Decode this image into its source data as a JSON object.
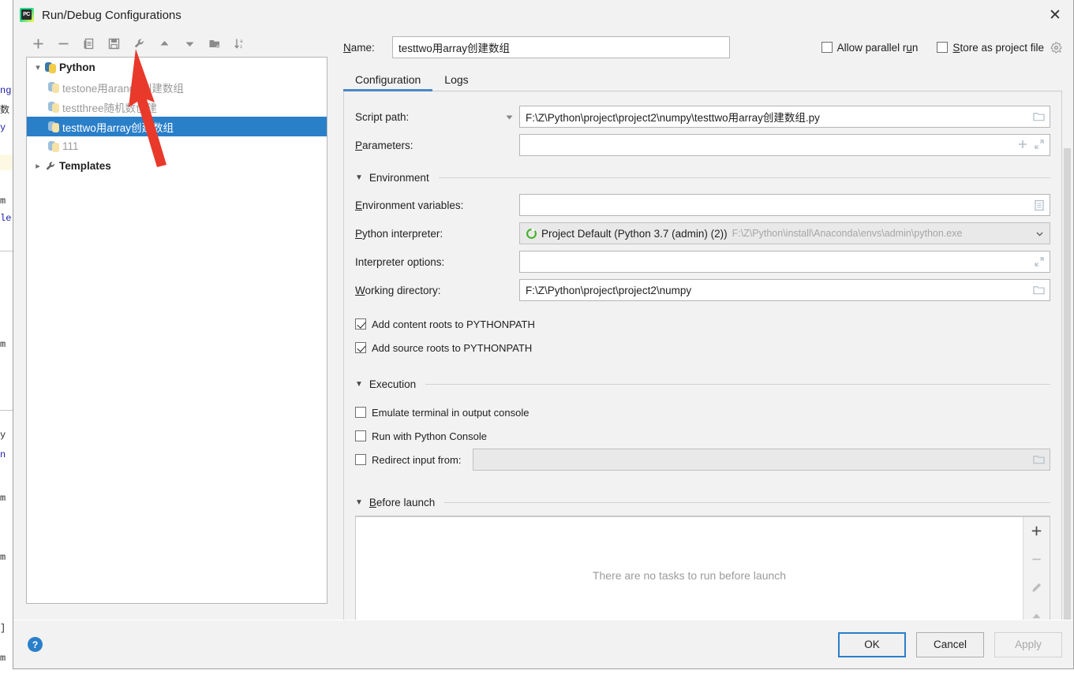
{
  "window": {
    "title": "Run/Debug Configurations",
    "app_icon": "pycharm-icon",
    "close_label": "✕"
  },
  "toolbar": {
    "buttons": [
      {
        "name": "add-configuration-button",
        "icon": "plus-icon",
        "label": "+"
      },
      {
        "name": "remove-configuration-button",
        "icon": "minus-icon",
        "label": "−"
      },
      {
        "name": "copy-configuration-button",
        "icon": "copy-icon",
        "label": ""
      },
      {
        "name": "save-configuration-button",
        "icon": "save-icon",
        "label": ""
      },
      {
        "name": "edit-templates-button",
        "icon": "wrench-icon",
        "label": ""
      },
      {
        "name": "move-up-button",
        "icon": "arrow-up-icon",
        "label": ""
      },
      {
        "name": "move-down-button",
        "icon": "arrow-down-icon",
        "label": ""
      },
      {
        "name": "new-folder-button",
        "icon": "folder-add-icon",
        "label": ""
      },
      {
        "name": "sort-alphabetically-button",
        "icon": "sort-az-icon",
        "label": ""
      }
    ]
  },
  "tree": {
    "nodes": [
      {
        "label": "Python",
        "type": "group",
        "expanded": true,
        "icon": "python-icon",
        "selected": false,
        "muted": false
      },
      {
        "label": "testone用arange创建数组",
        "type": "item",
        "icon": "python-icon",
        "selected": false,
        "muted": true
      },
      {
        "label": "testthree随机数创建",
        "type": "item",
        "icon": "python-icon",
        "selected": false,
        "muted": true
      },
      {
        "label": "testtwo用array创建数组",
        "type": "item",
        "icon": "python-icon",
        "selected": true,
        "muted": false
      },
      {
        "label": "111",
        "type": "item",
        "icon": "python-icon",
        "selected": false,
        "muted": true
      },
      {
        "label": "Templates",
        "type": "group",
        "expanded": false,
        "icon": "wrench-icon",
        "selected": false,
        "muted": false
      }
    ]
  },
  "name_row": {
    "label": "Name:",
    "label_mnemonic": "N",
    "value": "testtwo用array创建数组",
    "allow_parallel_run": {
      "label": "Allow parallel run",
      "checked": false
    },
    "store_as_project_file": {
      "label": "Store as project file",
      "checked": false
    },
    "gear_icon": "gear-icon"
  },
  "tabs": [
    {
      "label": "Configuration",
      "active": true
    },
    {
      "label": "Logs",
      "active": false
    }
  ],
  "configuration": {
    "script_path": {
      "label": "Script path:",
      "value": "F:\\Z\\Python\\project\\project2\\numpy\\testtwo用array创建数组.py",
      "browse_icon": "folder-icon",
      "dropdown_icon": "chevron-down-icon"
    },
    "parameters": {
      "label": "Parameters:",
      "value": "",
      "icons": [
        "plus-icon",
        "expand-icon"
      ]
    },
    "environment_section": {
      "title": "Environment",
      "expanded": true,
      "environment_variables": {
        "label": "Environment variables:",
        "value": "",
        "icon": "list-edit-icon"
      },
      "python_interpreter": {
        "label": "Python interpreter:",
        "value": "Project Default (Python 3.7 (admin) (2))",
        "path": "F:\\Z\\Python\\install\\Anaconda\\envs\\admin\\python.exe",
        "icon": "anaconda-icon",
        "dropdown_icon": "chevron-down-icon"
      },
      "interpreter_options": {
        "label": "Interpreter options:",
        "value": "",
        "icon": "expand-icon"
      },
      "working_directory": {
        "label": "Working directory:",
        "value": "F:\\Z\\Python\\project\\project2\\numpy",
        "browse_icon": "folder-icon"
      },
      "add_content_roots": {
        "label": "Add content roots to PYTHONPATH",
        "checked": true
      },
      "add_source_roots": {
        "label": "Add source roots to PYTHONPATH",
        "checked": true
      }
    },
    "execution_section": {
      "title": "Execution",
      "expanded": true,
      "emulate_terminal": {
        "label": "Emulate terminal in output console",
        "checked": false
      },
      "run_with_python_console": {
        "label": "Run with Python Console",
        "checked": false
      },
      "redirect_input_from": {
        "label": "Redirect input from:",
        "checked": false,
        "value": "",
        "browse_icon": "folder-icon"
      }
    },
    "before_launch": {
      "title": "Before launch",
      "title_mnemonic": "B",
      "expanded": true,
      "empty_text": "There are no tasks to run before launch",
      "tools": [
        {
          "name": "add-task-button",
          "icon": "plus-icon",
          "disabled": false
        },
        {
          "name": "remove-task-button",
          "icon": "minus-icon",
          "disabled": true
        },
        {
          "name": "edit-task-button",
          "icon": "pencil-icon",
          "disabled": true
        },
        {
          "name": "move-task-up-button",
          "icon": "arrow-up-icon",
          "disabled": true
        }
      ]
    }
  },
  "bottom_bar": {
    "help_icon": "help-icon",
    "help_glyph": "?",
    "ok": "OK",
    "cancel": "Cancel",
    "apply": "Apply",
    "apply_disabled": true
  },
  "annotation": {
    "type": "red-arrow",
    "color": "#e8392a",
    "points_to": "edit-templates-button"
  },
  "background_editor": {
    "fragments": [
      "ng",
      "数",
      "y",
      "m",
      "le",
      "y",
      "n",
      "m",
      "m",
      "]",
      "m"
    ]
  },
  "colors": {
    "accent": "#2a7fc9",
    "tab_underline": "#4a88c7",
    "selection": "#2a7fc9",
    "dialog_bg": "#f2f2f2",
    "annotation_red": "#e8392a"
  }
}
